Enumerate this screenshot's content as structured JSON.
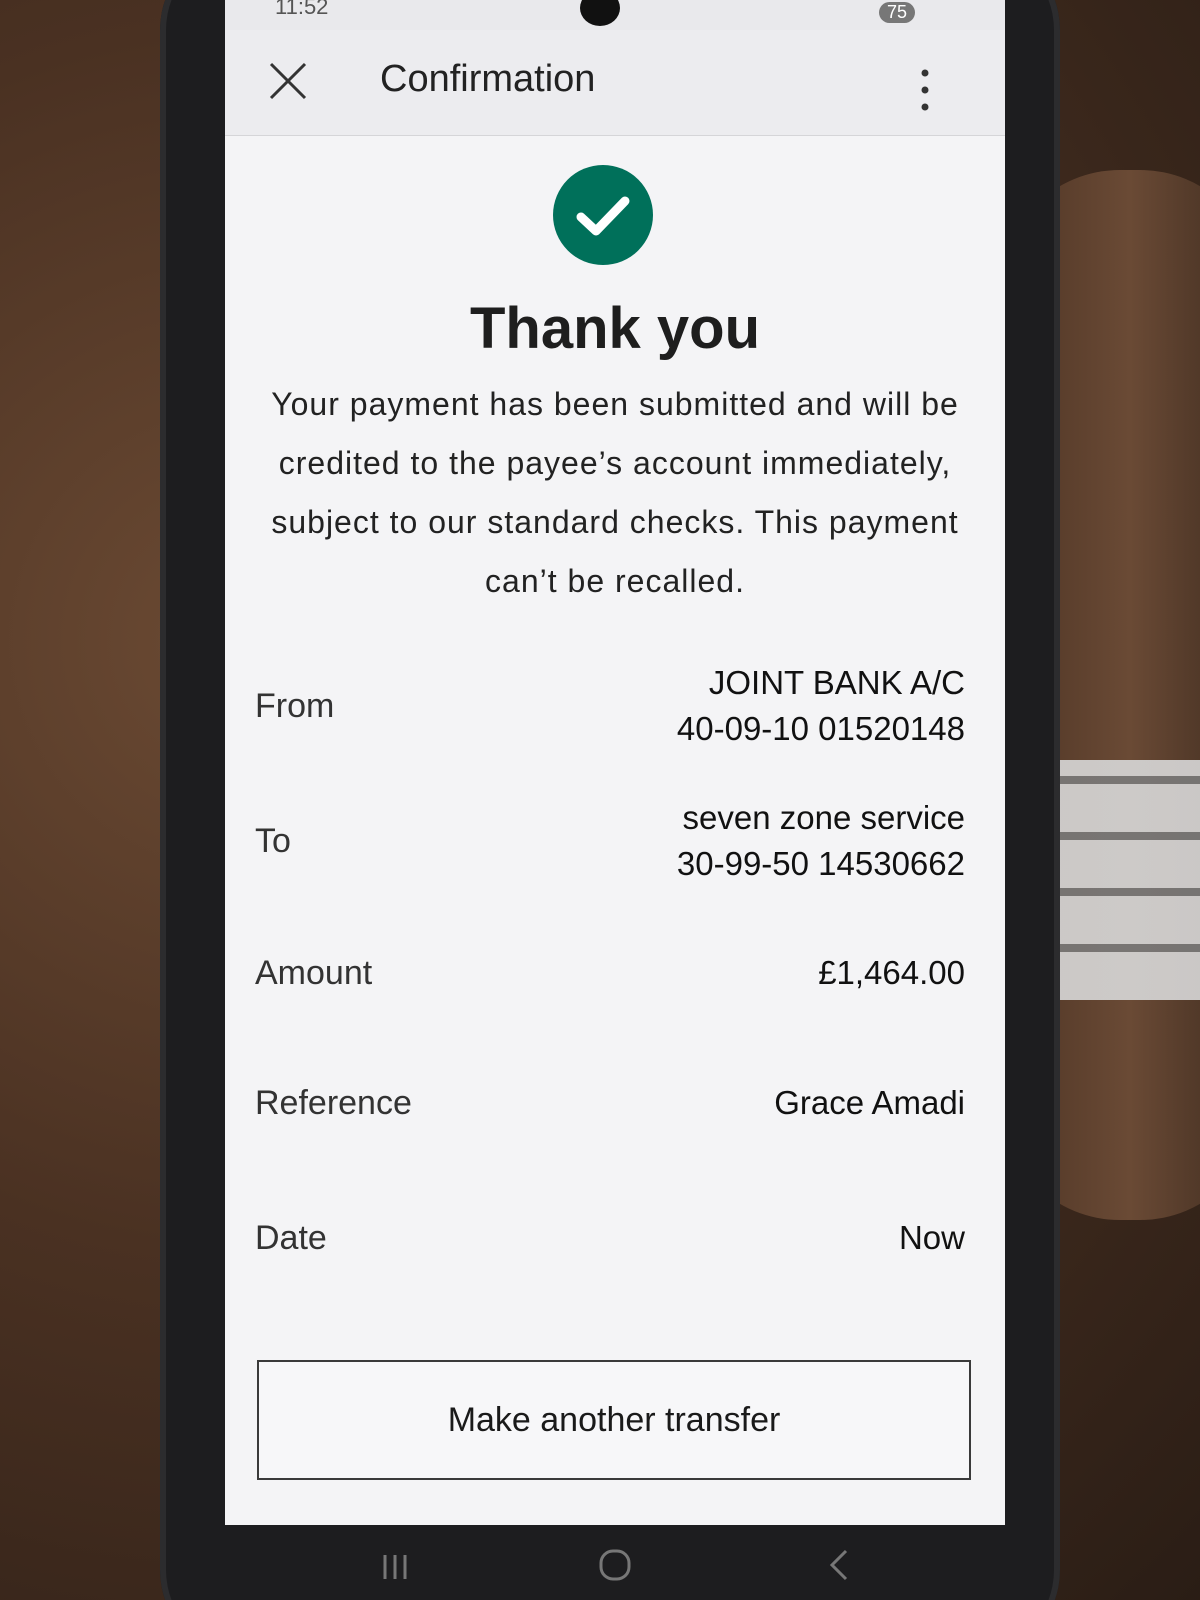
{
  "status_bar": {
    "time": "11:52",
    "battery": "75"
  },
  "header": {
    "title": "Confirmation"
  },
  "confirmation": {
    "heading": "Thank you",
    "message": "Your payment has been submitted and will be credited to the payee’s account immediately, subject to our standard checks. This payment can’t be recalled."
  },
  "details": {
    "from_label": "From",
    "from_name": "JOINT BANK A/C",
    "from_account": "40-09-10 01520148",
    "to_label": "To",
    "to_name": "seven zone service",
    "to_account": "30-99-50 14530662",
    "amount_label": "Amount",
    "amount_value": "£1,464.00",
    "reference_label": "Reference",
    "reference_value": "Grace Amadi",
    "date_label": "Date",
    "date_value": "Now"
  },
  "actions": {
    "make_another_transfer": "Make another transfer"
  },
  "colors": {
    "success_green": "#00705a",
    "background": "#f4f4f6"
  },
  "icons": [
    "close-icon",
    "more-vertical-icon",
    "checkmark-icon",
    "recent-apps-icon",
    "home-icon",
    "back-icon"
  ]
}
